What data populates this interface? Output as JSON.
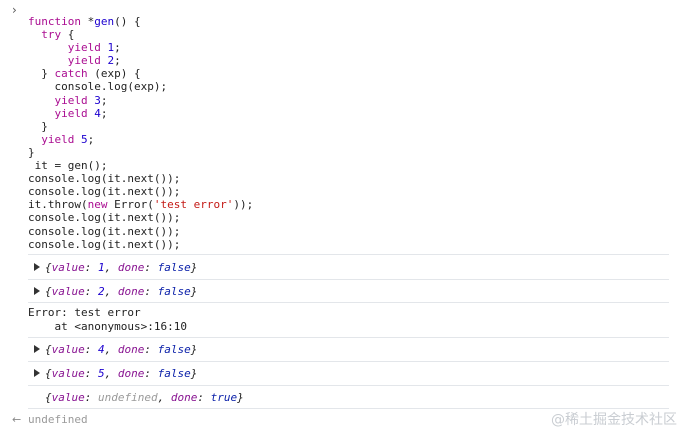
{
  "prompt_icon": "›",
  "code_lines": [
    [
      {
        "c": "kw",
        "t": "function "
      },
      {
        "c": "plain",
        "t": "*"
      },
      {
        "c": "fn",
        "t": "gen"
      },
      {
        "c": "plain",
        "t": "() {"
      }
    ],
    [
      {
        "c": "plain",
        "t": "  "
      },
      {
        "c": "kw",
        "t": "try"
      },
      {
        "c": "plain",
        "t": " {"
      }
    ],
    [
      {
        "c": "plain",
        "t": "      "
      },
      {
        "c": "kw",
        "t": "yield "
      },
      {
        "c": "num",
        "t": "1"
      },
      {
        "c": "plain",
        "t": ";"
      }
    ],
    [
      {
        "c": "plain",
        "t": "      "
      },
      {
        "c": "kw",
        "t": "yield "
      },
      {
        "c": "num",
        "t": "2"
      },
      {
        "c": "plain",
        "t": ";"
      }
    ],
    [
      {
        "c": "plain",
        "t": "  } "
      },
      {
        "c": "kw",
        "t": "catch"
      },
      {
        "c": "plain",
        "t": " (exp) {"
      }
    ],
    [
      {
        "c": "plain",
        "t": "    console.log(exp);"
      }
    ],
    [
      {
        "c": "plain",
        "t": "    "
      },
      {
        "c": "kw",
        "t": "yield "
      },
      {
        "c": "num",
        "t": "3"
      },
      {
        "c": "plain",
        "t": ";"
      }
    ],
    [
      {
        "c": "plain",
        "t": "    "
      },
      {
        "c": "kw",
        "t": "yield "
      },
      {
        "c": "num",
        "t": "4"
      },
      {
        "c": "plain",
        "t": ";"
      }
    ],
    [
      {
        "c": "plain",
        "t": "  }"
      }
    ],
    [
      {
        "c": "plain",
        "t": "  "
      },
      {
        "c": "kw",
        "t": "yield "
      },
      {
        "c": "num",
        "t": "5"
      },
      {
        "c": "plain",
        "t": ";"
      }
    ],
    [
      {
        "c": "plain",
        "t": "}"
      }
    ],
    [
      {
        "c": "plain",
        "t": " it = gen();"
      }
    ],
    [
      {
        "c": "plain",
        "t": "console.log(it.next());"
      }
    ],
    [
      {
        "c": "plain",
        "t": "console.log(it.next());"
      }
    ],
    [
      {
        "c": "plain",
        "t": "it.throw("
      },
      {
        "c": "kw",
        "t": "new "
      },
      {
        "c": "plain",
        "t": "Error("
      },
      {
        "c": "str",
        "t": "'test error'"
      },
      {
        "c": "plain",
        "t": "));"
      }
    ],
    [
      {
        "c": "plain",
        "t": "console.log(it.next());"
      }
    ],
    [
      {
        "c": "plain",
        "t": "console.log(it.next());"
      }
    ],
    [
      {
        "c": "plain",
        "t": "console.log(it.next());"
      }
    ]
  ],
  "logs": [
    {
      "value_key": "value",
      "value": "1",
      "value_kind": "num",
      "done_key": "done",
      "done": "false",
      "expandable": true
    },
    {
      "value_key": "value",
      "value": "2",
      "value_kind": "num",
      "done_key": "done",
      "done": "false",
      "expandable": true
    },
    {
      "value_key": "value",
      "value": "4",
      "value_kind": "num",
      "done_key": "done",
      "done": "false",
      "expandable": true
    },
    {
      "value_key": "value",
      "value": "5",
      "value_kind": "num",
      "done_key": "done",
      "done": "false",
      "expandable": true
    },
    {
      "value_key": "value",
      "value": "undefined",
      "value_kind": "undef",
      "done_key": "done",
      "done": "true",
      "expandable": false
    }
  ],
  "error": {
    "line1": "Error: test error",
    "line2": "    at <anonymous>:16:10"
  },
  "return_icon": "←",
  "return_value": "undefined",
  "watermark": "@稀土掘金技术社区",
  "colors": {
    "keyword": "#aa0d91",
    "number": "#1c00cf",
    "string": "#c41a16",
    "object_key": "#881391",
    "undefined": "#9a9a9a",
    "divider": "#e3e6ea"
  }
}
